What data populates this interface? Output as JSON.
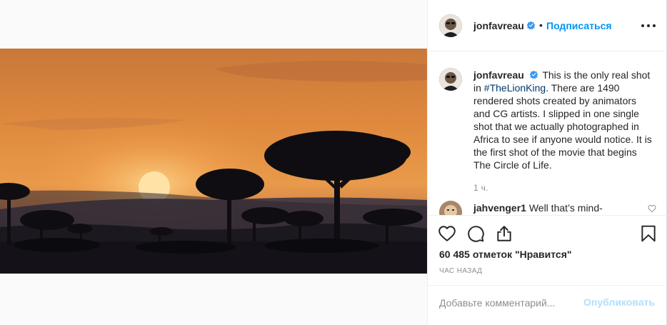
{
  "colors": {
    "accent": "#0095f6",
    "hashtag": "#00376b",
    "muted": "#8e8e8e",
    "post_disabled": "#b2dffc",
    "verified": "#3897f0"
  },
  "post": {
    "photo_alt": "sunset-savanna-photo",
    "author": {
      "username": "jonfavreau",
      "verified_icon": "verified-badge-icon",
      "dot": "•",
      "follow_label": "Подписаться",
      "more_icon": "more-options-icon"
    },
    "caption": {
      "username": "jonfavreau",
      "text_before": "This is the only real shot in ",
      "hashtag": "#TheLionKing",
      "text_after": ". There are 1490 rendered shots created by animators and CG artists. I slipped in one single shot that we actually photographed in Africa to see if anyone would notice. It is the first shot of the movie that begins The Circle of Life.",
      "time": "1 ч."
    },
    "comments": [
      {
        "username": "jahvenger1",
        "text": "Well that’s mind-"
      }
    ],
    "actions": {
      "like_icon": "heart-icon",
      "comment_icon": "comment-icon",
      "share_icon": "share-icon",
      "save_icon": "bookmark-icon"
    },
    "likes": {
      "count": "60 485",
      "label": "отметок \"Нравится\""
    },
    "timestamp": "час назад",
    "add_comment": {
      "placeholder": "Добавьте комментарий...",
      "post_label": "Опубликовать"
    }
  }
}
